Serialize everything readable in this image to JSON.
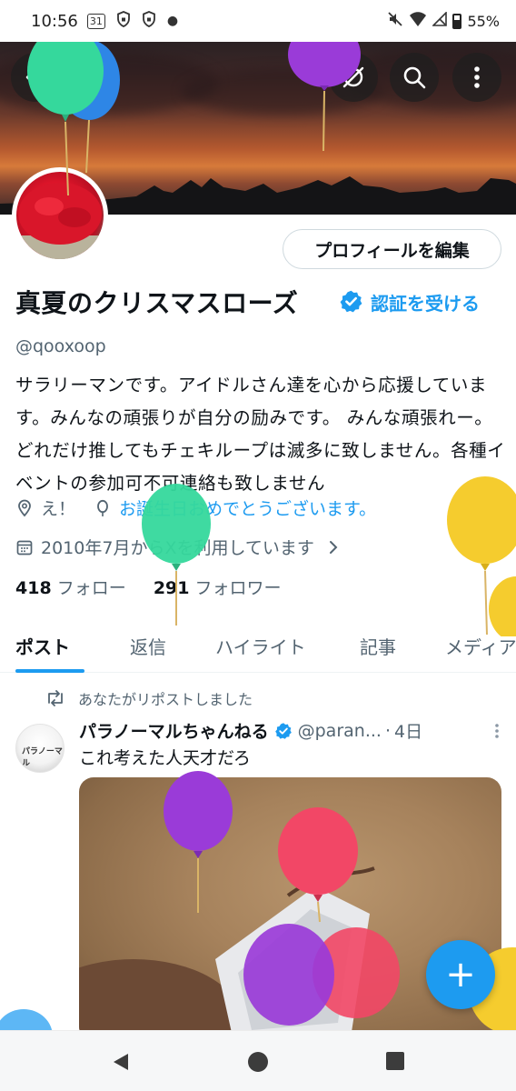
{
  "status_bar": {
    "time": "10:56",
    "calendar_day": "31",
    "battery": "55%"
  },
  "profile": {
    "edit_button": "プロフィールを編集",
    "name": "真夏のクリスマスローズ",
    "verify_link": "認証を受ける",
    "handle": "@qooxoop",
    "bio": "サラリーマンです。アイドルさん達を心から応援しています。みんなの頑張りが自分の励みです。 みんな頑張れー。どれだけ推してもチェキループは滅多に致しません。各種イベントの参加可不可連絡も致しません",
    "location": "え！",
    "birthday_text": "お誕生日おめでとうございます。",
    "joined": "2010年7月からXを利用しています",
    "following_count": "418",
    "following_label": "フォロー",
    "followers_count": "291",
    "followers_label": "フォロワー"
  },
  "tabs": [
    "ポスト",
    "返信",
    "ハイライト",
    "記事",
    "メディア"
  ],
  "post": {
    "repost_label": "あなたがリポストしました",
    "avatar_text": "パラノーマル",
    "author": "パラノーマルちゃんねる",
    "handle": "@paran...",
    "separator": "·",
    "time": "4日",
    "text": "これ考えた人天才だろ"
  },
  "fab_label": "+",
  "colors": {
    "accent": "#1d9bf0",
    "text": "#0f1419",
    "muted": "#536471"
  },
  "icons": [
    "back-icon",
    "hide-icon",
    "search-icon",
    "more-icon",
    "verified-badge-icon",
    "location-icon",
    "balloon-icon",
    "calendar-icon",
    "chevron-right-icon",
    "repost-icon",
    "post-more-icon",
    "compose-icon",
    "nav-back-icon",
    "nav-home-icon",
    "nav-recents-icon"
  ]
}
